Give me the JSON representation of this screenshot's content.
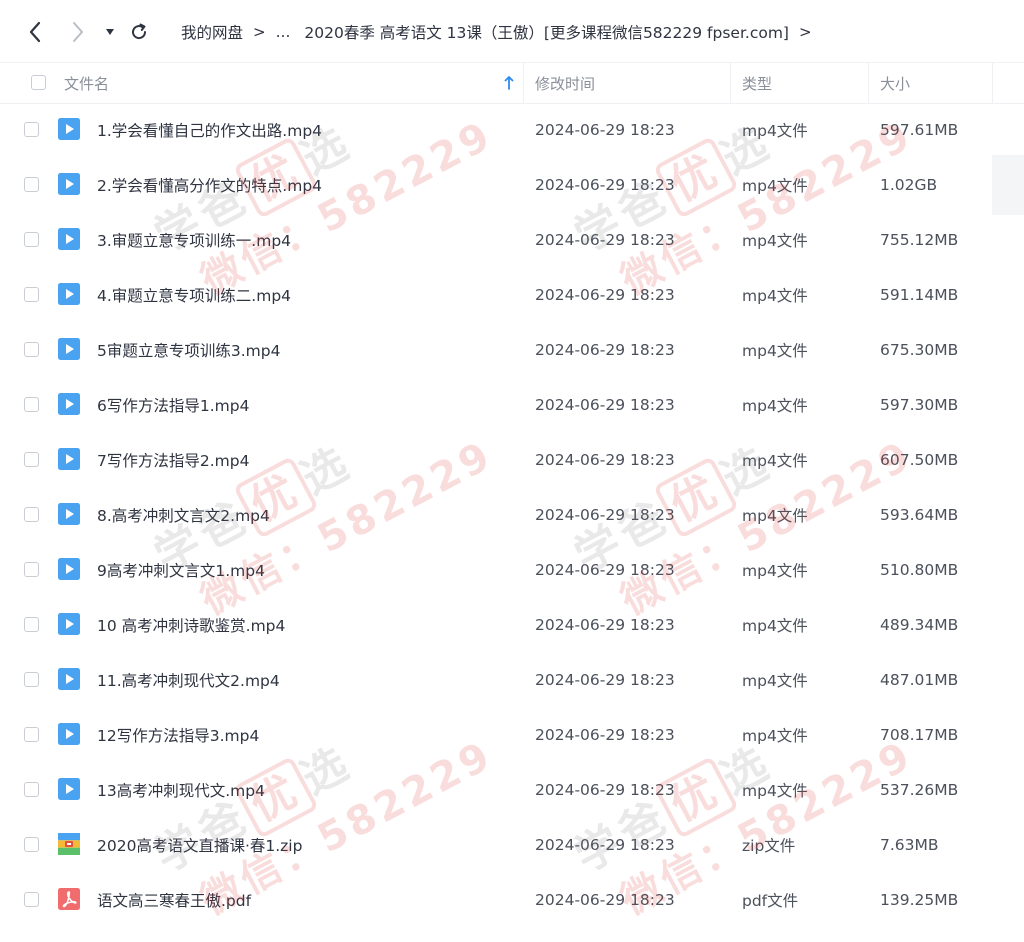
{
  "toolbar": {
    "back_icon": "chevron-left-icon",
    "forward_icon": "chevron-right-icon",
    "history_icon": "caret-down-icon",
    "refresh_icon": "refresh-icon"
  },
  "breadcrumb": {
    "root": "我的网盘",
    "ellipsis": "...",
    "current": "2020春季 高考语文 13课（王傲）[更多课程微信582229 fpser.com]"
  },
  "columns": {
    "name": "文件名",
    "modified": "修改时间",
    "type": "类型",
    "size": "大小"
  },
  "files": [
    {
      "name": "1.学会看懂自己的作文出路.mp4",
      "date": "2024-06-29 18:23",
      "type": "mp4文件",
      "size": "597.61MB",
      "icon": "video-icon"
    },
    {
      "name": "2.学会看懂高分作文的特点.mp4",
      "date": "2024-06-29 18:23",
      "type": "mp4文件",
      "size": "1.02GB",
      "icon": "video-icon"
    },
    {
      "name": "3.审题立意专项训练一.mp4",
      "date": "2024-06-29 18:23",
      "type": "mp4文件",
      "size": "755.12MB",
      "icon": "video-icon"
    },
    {
      "name": "4.审题立意专项训练二.mp4",
      "date": "2024-06-29 18:23",
      "type": "mp4文件",
      "size": "591.14MB",
      "icon": "video-icon"
    },
    {
      "name": "5审题立意专项训练3.mp4",
      "date": "2024-06-29 18:23",
      "type": "mp4文件",
      "size": "675.30MB",
      "icon": "video-icon"
    },
    {
      "name": "6写作方法指导1.mp4",
      "date": "2024-06-29 18:23",
      "type": "mp4文件",
      "size": "597.30MB",
      "icon": "video-icon"
    },
    {
      "name": "7写作方法指导2.mp4",
      "date": "2024-06-29 18:23",
      "type": "mp4文件",
      "size": "607.50MB",
      "icon": "video-icon"
    },
    {
      "name": "8.高考冲刺文言文2.mp4",
      "date": "2024-06-29 18:23",
      "type": "mp4文件",
      "size": "593.64MB",
      "icon": "video-icon"
    },
    {
      "name": "9高考冲刺文言文1.mp4",
      "date": "2024-06-29 18:23",
      "type": "mp4文件",
      "size": "510.80MB",
      "icon": "video-icon"
    },
    {
      "name": "10 高考冲刺诗歌鉴赏.mp4",
      "date": "2024-06-29 18:23",
      "type": "mp4文件",
      "size": "489.34MB",
      "icon": "video-icon"
    },
    {
      "name": "11.高考冲刺现代文2.mp4",
      "date": "2024-06-29 18:23",
      "type": "mp4文件",
      "size": "487.01MB",
      "icon": "video-icon"
    },
    {
      "name": "12写作方法指导3.mp4",
      "date": "2024-06-29 18:23",
      "type": "mp4文件",
      "size": "708.17MB",
      "icon": "video-icon"
    },
    {
      "name": "13高考冲刺现代文.mp4",
      "date": "2024-06-29 18:23",
      "type": "mp4文件",
      "size": "537.26MB",
      "icon": "video-icon"
    },
    {
      "name": "2020高考语文直播课·春1.zip",
      "date": "2024-06-29 18:23",
      "type": "zip文件",
      "size": "7.63MB",
      "icon": "zip-icon"
    },
    {
      "name": "语文高三寒春王傲.pdf",
      "date": "2024-06-29 18:23",
      "type": "pdf文件",
      "size": "139.25MB",
      "icon": "pdf-icon"
    }
  ],
  "watermark": {
    "line1_a": "学爸",
    "line1_b": "优",
    "line1_c": "选",
    "line2": "微信：582229"
  },
  "colors": {
    "accent": "#2b8cf3",
    "video_icon": "#4aa3f0",
    "pdf_icon": "#f16d6d",
    "watermark_red": "#dd3333"
  }
}
